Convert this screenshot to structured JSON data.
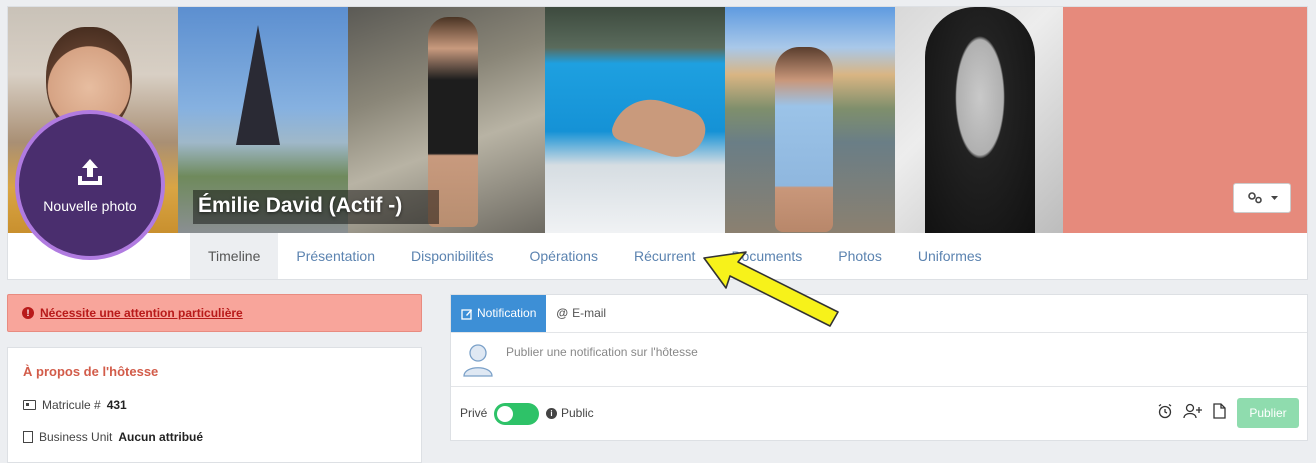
{
  "profile": {
    "name": "Émilie David (Actif -)",
    "avatar_label": "Nouvelle photo",
    "settings_icon": "gears-icon",
    "cover_accent": "#e68a7c",
    "avatar_bg": "#4a2e6e",
    "avatar_ring": "#b07be0"
  },
  "tabs": [
    {
      "label": "Timeline",
      "active": true
    },
    {
      "label": "Présentation"
    },
    {
      "label": "Disponibilités"
    },
    {
      "label": "Opérations"
    },
    {
      "label": "Récurrent"
    },
    {
      "label": "Documents"
    },
    {
      "label": "Photos"
    },
    {
      "label": "Uniformes"
    }
  ],
  "alert": {
    "text": "Nécessite une attention particulière",
    "color": "#b81a1a"
  },
  "about": {
    "title": "À propos de l'hôtesse",
    "matricule_label": "Matricule #",
    "matricule_value": "431",
    "bu_label": "Business Unit",
    "bu_value": "Aucun attribué"
  },
  "panel": {
    "tab_notification": "Notification",
    "tab_email": "E-mail",
    "placeholder": "Publier une notification sur l'hôtesse",
    "private_label": "Privé",
    "public_label": "Public",
    "publish_label": "Publier",
    "accent": "#3d8fd6",
    "toggle_color": "#2ec268"
  }
}
